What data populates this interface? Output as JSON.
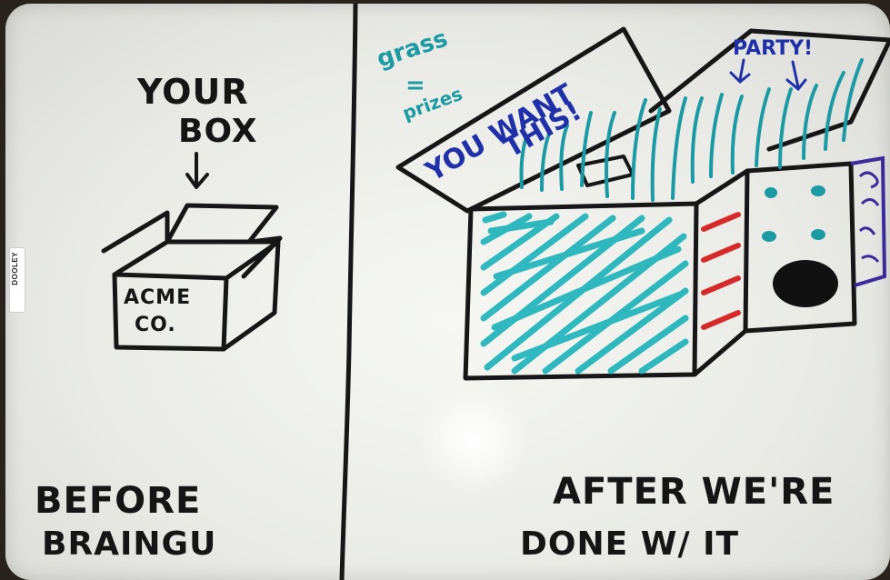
{
  "left_panel": {
    "label_top": "YOUR",
    "label_bottom": "BOX",
    "box_line1": "ACME",
    "box_line2": "CO.",
    "caption_line1": "BEFORE",
    "caption_line2": "BRAINGU"
  },
  "right_panel": {
    "note_top": "grass",
    "note_eq": "=",
    "note_bottom": "prizes",
    "flap_line1": "YOU WANT",
    "flap_line2": "THIS!",
    "party_label": "PARTY!",
    "caption_line1": "AFTER WE'RE",
    "caption_line2": "DONE W/ IT"
  },
  "brand": "DOOLEY",
  "colors": {
    "ink": "#161616",
    "teal": "#1c9aa3",
    "blue": "#2030a8",
    "red": "#d62a2a",
    "purple": "#3a2a9a"
  }
}
